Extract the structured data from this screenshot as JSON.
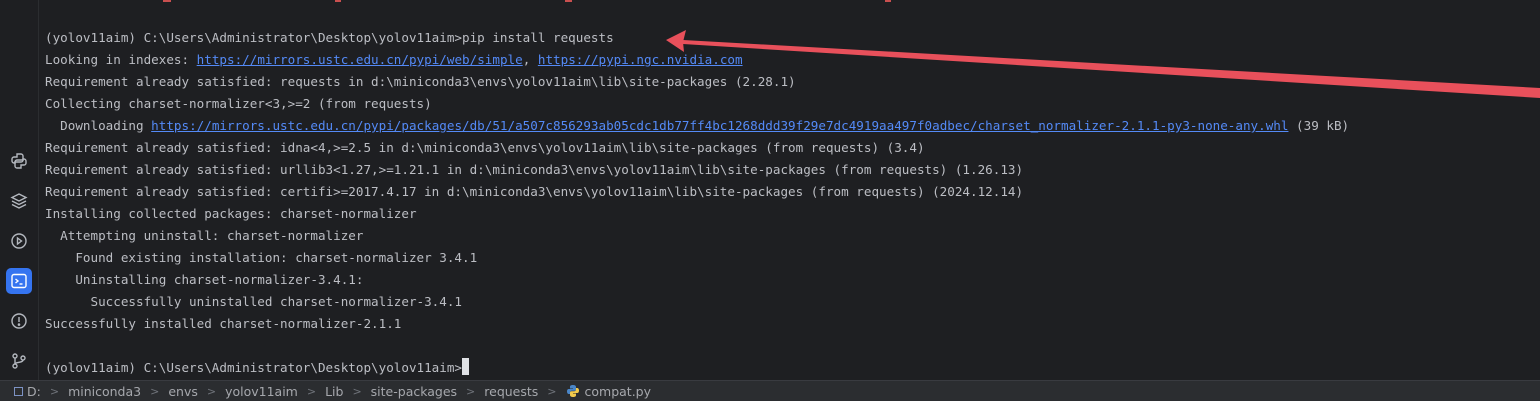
{
  "terminal": {
    "prompt_line": {
      "prompt": "(yolov11aim) C:\\Users\\Administrator\\Desktop\\yolov11aim>",
      "command": "pip install requests"
    },
    "looking_in": {
      "prefix": "Looking in indexes: ",
      "link1": "https://mirrors.ustc.edu.cn/pypi/web/simple",
      "sep": ", ",
      "link2": "https://pypi.ngc.nvidia.com"
    },
    "req_requests": "Requirement already satisfied: requests in d:\\miniconda3\\envs\\yolov11aim\\lib\\site-packages (2.28.1)",
    "collecting": "Collecting charset-normalizer<3,>=2 (from requests)",
    "downloading": {
      "prefix": "  Downloading ",
      "link": "https://mirrors.ustc.edu.cn/pypi/packages/db/51/a507c856293ab05cdc1db77ff4bc1268ddd39f29e7dc4919aa497f0adbec/charset_normalizer-2.1.1-py3-none-any.whl",
      "suffix": " (39 kB)"
    },
    "req_idna": "Requirement already satisfied: idna<4,>=2.5 in d:\\miniconda3\\envs\\yolov11aim\\lib\\site-packages (from requests) (3.4)",
    "req_urllib3": "Requirement already satisfied: urllib3<1.27,>=1.21.1 in d:\\miniconda3\\envs\\yolov11aim\\lib\\site-packages (from requests) (1.26.13)",
    "req_certifi": "Requirement already satisfied: certifi>=2017.4.17 in d:\\miniconda3\\envs\\yolov11aim\\lib\\site-packages (from requests) (2024.12.14)",
    "installing": "Installing collected packages: charset-normalizer",
    "attempting": "  Attempting uninstall: charset-normalizer",
    "found": "    Found existing installation: charset-normalizer 3.4.1",
    "uninstalling": "    Uninstalling charset-normalizer-3.4.1:",
    "uninstalled": "      Successfully uninstalled charset-normalizer-3.4.1",
    "success": "Successfully installed charset-normalizer-2.1.1",
    "final_prompt": "(yolov11aim) C:\\Users\\Administrator\\Desktop\\yolov11aim>"
  },
  "sidebar": {
    "tools": [
      {
        "name": "python-console-icon"
      },
      {
        "name": "python-packages-icon"
      },
      {
        "name": "services-icon"
      },
      {
        "name": "terminal-icon",
        "active": true
      },
      {
        "name": "problems-icon"
      },
      {
        "name": "version-control-icon"
      }
    ]
  },
  "breadcrumb": {
    "items": [
      "D:",
      "miniconda3",
      "envs",
      "yolov11aim",
      "Lib",
      "site-packages",
      "requests",
      "compat.py"
    ]
  },
  "colors": {
    "background": "#1e1f22",
    "text": "#bcbec4",
    "link": "#548af7",
    "annotation_arrow": "#e8505b",
    "active_tool": "#3574f0"
  }
}
